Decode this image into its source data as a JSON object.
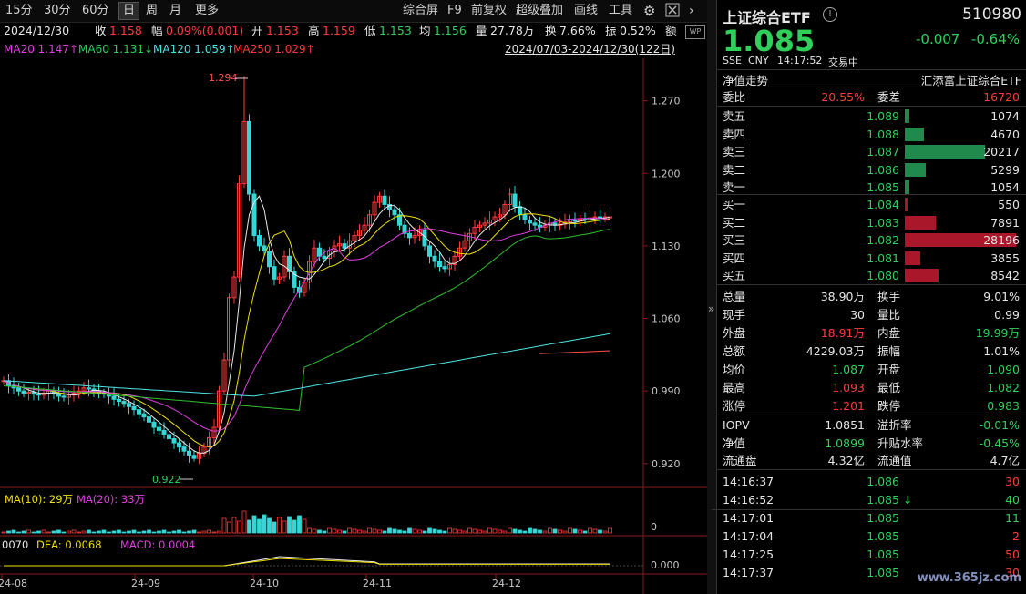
{
  "toolbar": {
    "timeframes": [
      "15分",
      "30分",
      "60分",
      "日",
      "周",
      "月",
      "更多"
    ],
    "active_timeframe": "日",
    "tools": [
      "综合屏",
      "F9",
      "前复权",
      "超级叠加",
      "画线",
      "工具"
    ]
  },
  "info_bar": {
    "date": "2024/12/30",
    "close_label": "收",
    "close": "1.158",
    "range_label": "幅",
    "range": "0.09%(0.001)",
    "open_label": "开",
    "open": "1.153",
    "high_label": "高",
    "high": "1.159",
    "low_label": "低",
    "low": "1.153",
    "avg_label": "均",
    "avg": "1.156",
    "vol_label": "量",
    "vol": "27.78万",
    "turnover_label": "换",
    "turnover": "7.66%",
    "amp_label": "振",
    "amp": "0.52%",
    "amount_label": "额"
  },
  "ma_bar": {
    "ma20": "MA20 1.147↑",
    "ma60": "MA60 1.131↓",
    "ma120": "MA120 1.059↑",
    "ma250": "MA250 1.029↑",
    "period": "2024/07/03-2024/12/30(122日)"
  },
  "chart_data": {
    "type": "candlestick",
    "price_ticks": [
      "1.270",
      "1.200",
      "1.130",
      "1.060",
      "0.990",
      "0.920"
    ],
    "high_label": "1.294",
    "low_label": "0.922",
    "x_ticks": [
      "24-08",
      "24-09",
      "24-10",
      "24-11",
      "24-12"
    ],
    "vol_legend": {
      "ma10": "MA(10): 29万",
      "ma20": "MA(20): 33万"
    },
    "vol_tick": "0",
    "macd_legend": {
      "dif": "0070",
      "dea": "DEA: 0.0068",
      "macd": "MACD: 0.0004"
    },
    "macd_tick": "0.000",
    "colors": {
      "up": "#ff3b3b",
      "down": "#35d6d6",
      "ma5": "#e8e8e8",
      "ma10": "#f0e000",
      "ma20": "#e040e0",
      "ma60": "#2fbf2f",
      "ma120": "#4fe3e3",
      "ma250": "#ff5050"
    }
  },
  "quote": {
    "name": "上证综合ETF",
    "code": "510980",
    "price": "1.085",
    "change": "-0.007",
    "change_pct": "-0.64%",
    "market": "SSE",
    "currency": "CNY",
    "time": "14:17:52",
    "status": "交易中"
  },
  "panel": {
    "trend_label": "净值走势",
    "fund_name": "汇添富上证综合ETF",
    "weibi_label": "委比",
    "weibi": "20.55%",
    "weicha_label": "委差",
    "weicha": "16720",
    "asks": [
      {
        "label": "卖五",
        "price": "1.089",
        "vol": "1074",
        "ratio": 0.04
      },
      {
        "label": "卖四",
        "price": "1.088",
        "vol": "4670",
        "ratio": 0.17
      },
      {
        "label": "卖三",
        "price": "1.087",
        "vol": "20217",
        "ratio": 0.72
      },
      {
        "label": "卖二",
        "price": "1.086",
        "vol": "5299",
        "ratio": 0.19
      },
      {
        "label": "卖一",
        "price": "1.085",
        "vol": "1054",
        "ratio": 0.04
      }
    ],
    "bids": [
      {
        "label": "买一",
        "price": "1.084",
        "vol": "550",
        "ratio": 0.02
      },
      {
        "label": "买二",
        "price": "1.083",
        "vol": "7891",
        "ratio": 0.28
      },
      {
        "label": "买三",
        "price": "1.082",
        "vol": "28196",
        "ratio": 1.0
      },
      {
        "label": "买四",
        "price": "1.081",
        "vol": "3855",
        "ratio": 0.14
      },
      {
        "label": "买五",
        "price": "1.080",
        "vol": "8542",
        "ratio": 0.3
      }
    ],
    "stats": [
      {
        "k1": "总量",
        "v1": "38.90万",
        "c1": "white",
        "k2": "换手",
        "v2": "9.01%",
        "c2": "white"
      },
      {
        "k1": "现手",
        "v1": "30",
        "c1": "white",
        "k2": "量比",
        "v2": "0.99",
        "c2": "white"
      },
      {
        "k1": "外盘",
        "v1": "18.91万",
        "c1": "red",
        "k2": "内盘",
        "v2": "19.99万",
        "c2": "green"
      },
      {
        "k1": "总额",
        "v1": "4229.03万",
        "c1": "white",
        "k2": "振幅",
        "v2": "1.01%",
        "c2": "white"
      },
      {
        "k1": "均价",
        "v1": "1.087",
        "c1": "green",
        "k2": "开盘",
        "v2": "1.090",
        "c2": "green"
      },
      {
        "k1": "最高",
        "v1": "1.093",
        "c1": "red",
        "k2": "最低",
        "v2": "1.082",
        "c2": "green"
      },
      {
        "k1": "涨停",
        "v1": "1.201",
        "c1": "red",
        "k2": "跌停",
        "v2": "0.983",
        "c2": "green"
      }
    ],
    "fund_stats": [
      {
        "k1": "IOPV",
        "v1": "1.0851",
        "c1": "white",
        "k2": "溢折率",
        "v2": "-0.01%",
        "c2": "green"
      },
      {
        "k1": "净值",
        "v1": "1.0899",
        "c1": "green",
        "k2": "升贴水率",
        "v2": "-0.45%",
        "c2": "green"
      },
      {
        "k1": "流通盘",
        "v1": "4.32亿",
        "c1": "white",
        "k2": "流通值",
        "v2": "4.7亿",
        "c2": "white"
      }
    ],
    "ticks": [
      {
        "time": "14:16:37",
        "price": "1.086",
        "arrow": "",
        "qty": "30",
        "qc": "red"
      },
      {
        "time": "14:16:52",
        "price": "1.085",
        "arrow": "↓",
        "qty": "40",
        "qc": "green"
      },
      {
        "time": "14:17:01",
        "price": "1.085",
        "arrow": "",
        "qty": "11",
        "qc": "green"
      },
      {
        "time": "14:17:04",
        "price": "1.085",
        "arrow": "",
        "qty": "2",
        "qc": "red"
      },
      {
        "time": "14:17:25",
        "price": "1.085",
        "arrow": "",
        "qty": "50",
        "qc": "red"
      },
      {
        "time": "14:17:37",
        "price": "1.085",
        "arrow": "",
        "qty": "30",
        "qc": "red"
      }
    ]
  },
  "watermark": "www.365jz.com"
}
